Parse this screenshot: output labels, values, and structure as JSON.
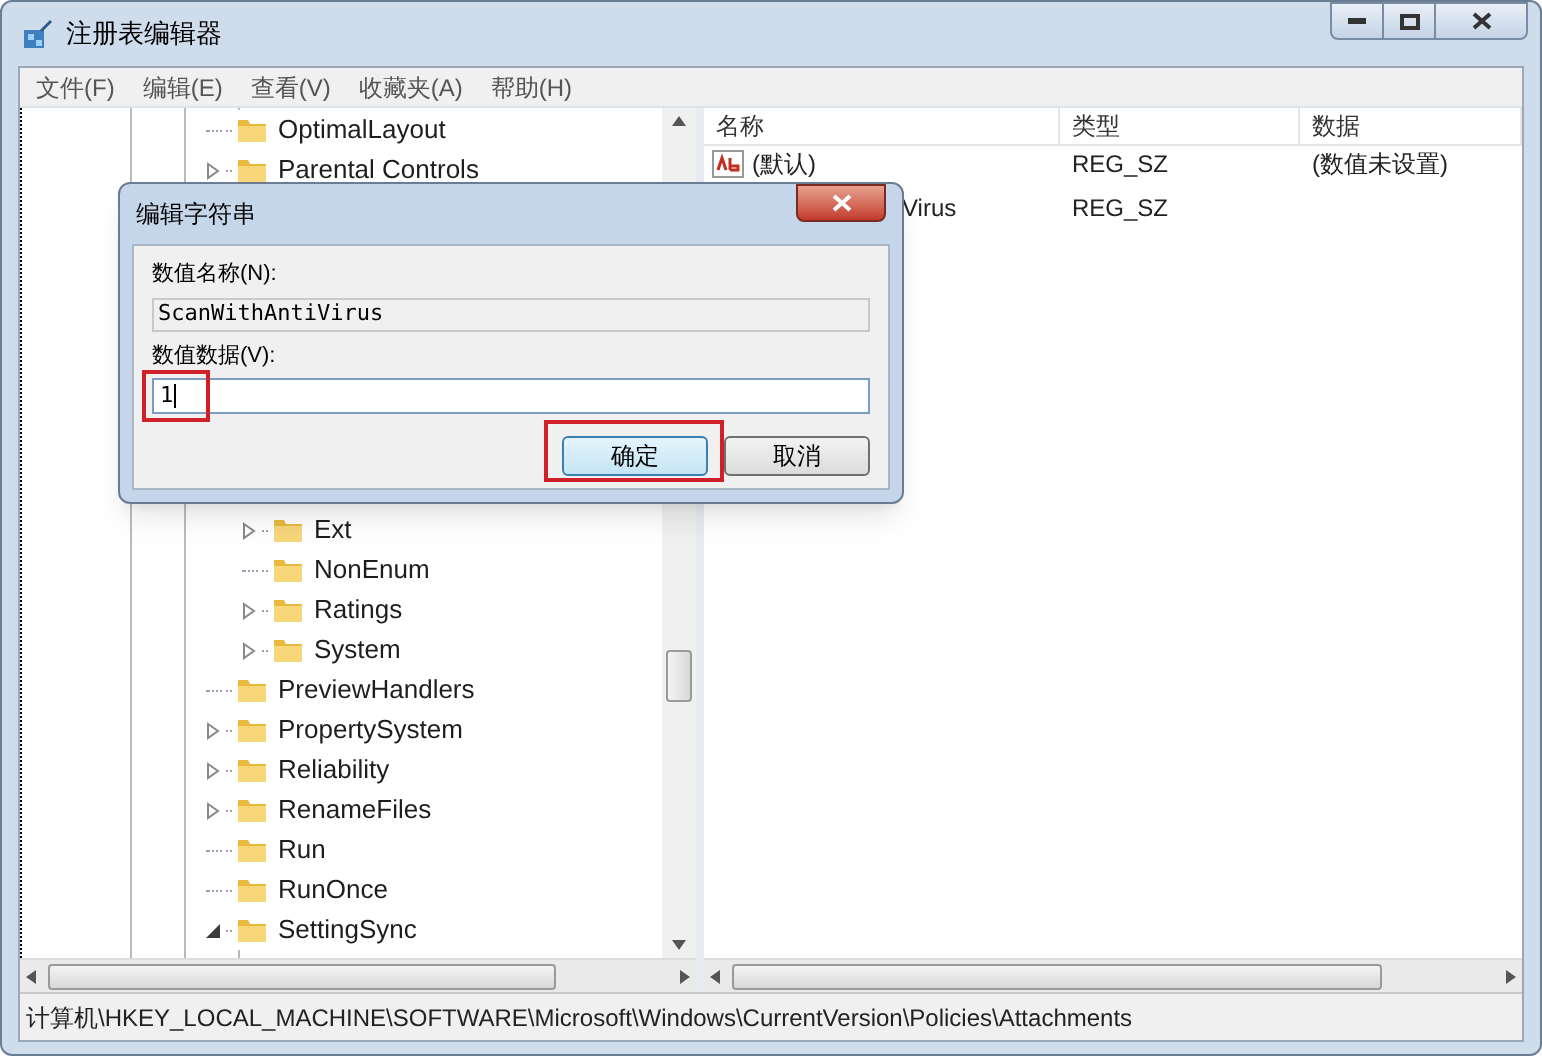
{
  "window": {
    "title": "注册表编辑器"
  },
  "menu": [
    {
      "label": "文件(F)"
    },
    {
      "label": "编辑(E)"
    },
    {
      "label": "查看(V)"
    },
    {
      "label": "收藏夹(A)"
    },
    {
      "label": "帮助(H)"
    }
  ],
  "tree": [
    {
      "label": "OptimalLayout"
    },
    {
      "label": "Parental Controls",
      "expanded": false
    },
    {
      "kind": "covered",
      "children": [
        {
          "label": "Ext",
          "expanded": false
        },
        {
          "label": "NonEnum"
        },
        {
          "label": "Ratings",
          "expanded": false
        },
        {
          "label": "System",
          "expanded": false
        }
      ]
    },
    {
      "label": "PreviewHandlers"
    },
    {
      "label": "PropertySystem",
      "expanded": false
    },
    {
      "label": "Reliability",
      "expanded": false
    },
    {
      "label": "RenameFiles",
      "expanded": false
    },
    {
      "label": "Run"
    },
    {
      "label": "RunOnce"
    },
    {
      "label": "SettingSync",
      "expanded": true
    }
  ],
  "values": {
    "columns": [
      "名称",
      "类型",
      "数据"
    ],
    "rows": [
      {
        "kind": "whole",
        "name": "(默认)",
        "type": "REG_SZ",
        "data": "(数值未设置)"
      },
      {
        "kind": "cut",
        "name": "Virus",
        "type": "REG_SZ"
      }
    ]
  },
  "status_bar": "计算机\\HKEY_LOCAL_MACHINE\\SOFTWARE\\Microsoft\\Windows\\CurrentVersion\\Policies\\Attachments",
  "dialog": {
    "title": "编辑字符串",
    "name_label": "数值名称(N):",
    "name_value": "ScanWithAntiVirus",
    "data_label": "数值数据(V):",
    "data_value": "1",
    "data_highlighted": true,
    "buttons": [
      {
        "label": "确定",
        "default": true,
        "highlighted": true
      },
      {
        "label": "取消",
        "default": false,
        "highlighted": false
      }
    ]
  }
}
